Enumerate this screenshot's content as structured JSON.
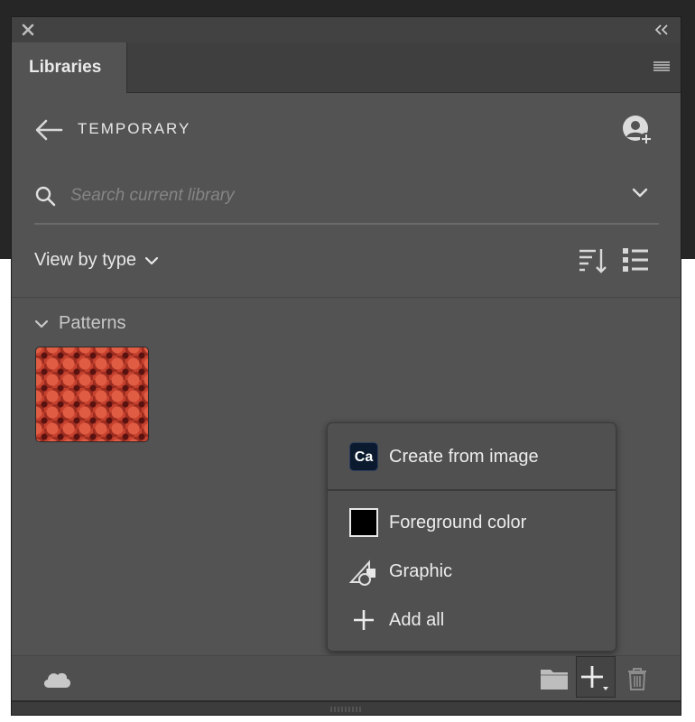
{
  "panel": {
    "tab_label": "Libraries"
  },
  "header": {
    "library_name": "TEMPORARY"
  },
  "search": {
    "placeholder": "Search current library"
  },
  "view": {
    "view_by_label": "View by type"
  },
  "section": {
    "title": "Patterns"
  },
  "add_menu": {
    "items": [
      {
        "label": "Create from image",
        "icon": "capture-icon",
        "badge": "Ca"
      },
      {
        "label": "Foreground color",
        "icon": "color-swatch-icon",
        "swatch_color": "#000000"
      },
      {
        "label": "Graphic",
        "icon": "graphic-icon"
      },
      {
        "label": "Add all",
        "icon": "plus-icon"
      }
    ]
  },
  "colors": {
    "panel_bg": "#535353",
    "topband_bg": "#262626",
    "pattern_red": "#c5412e"
  }
}
